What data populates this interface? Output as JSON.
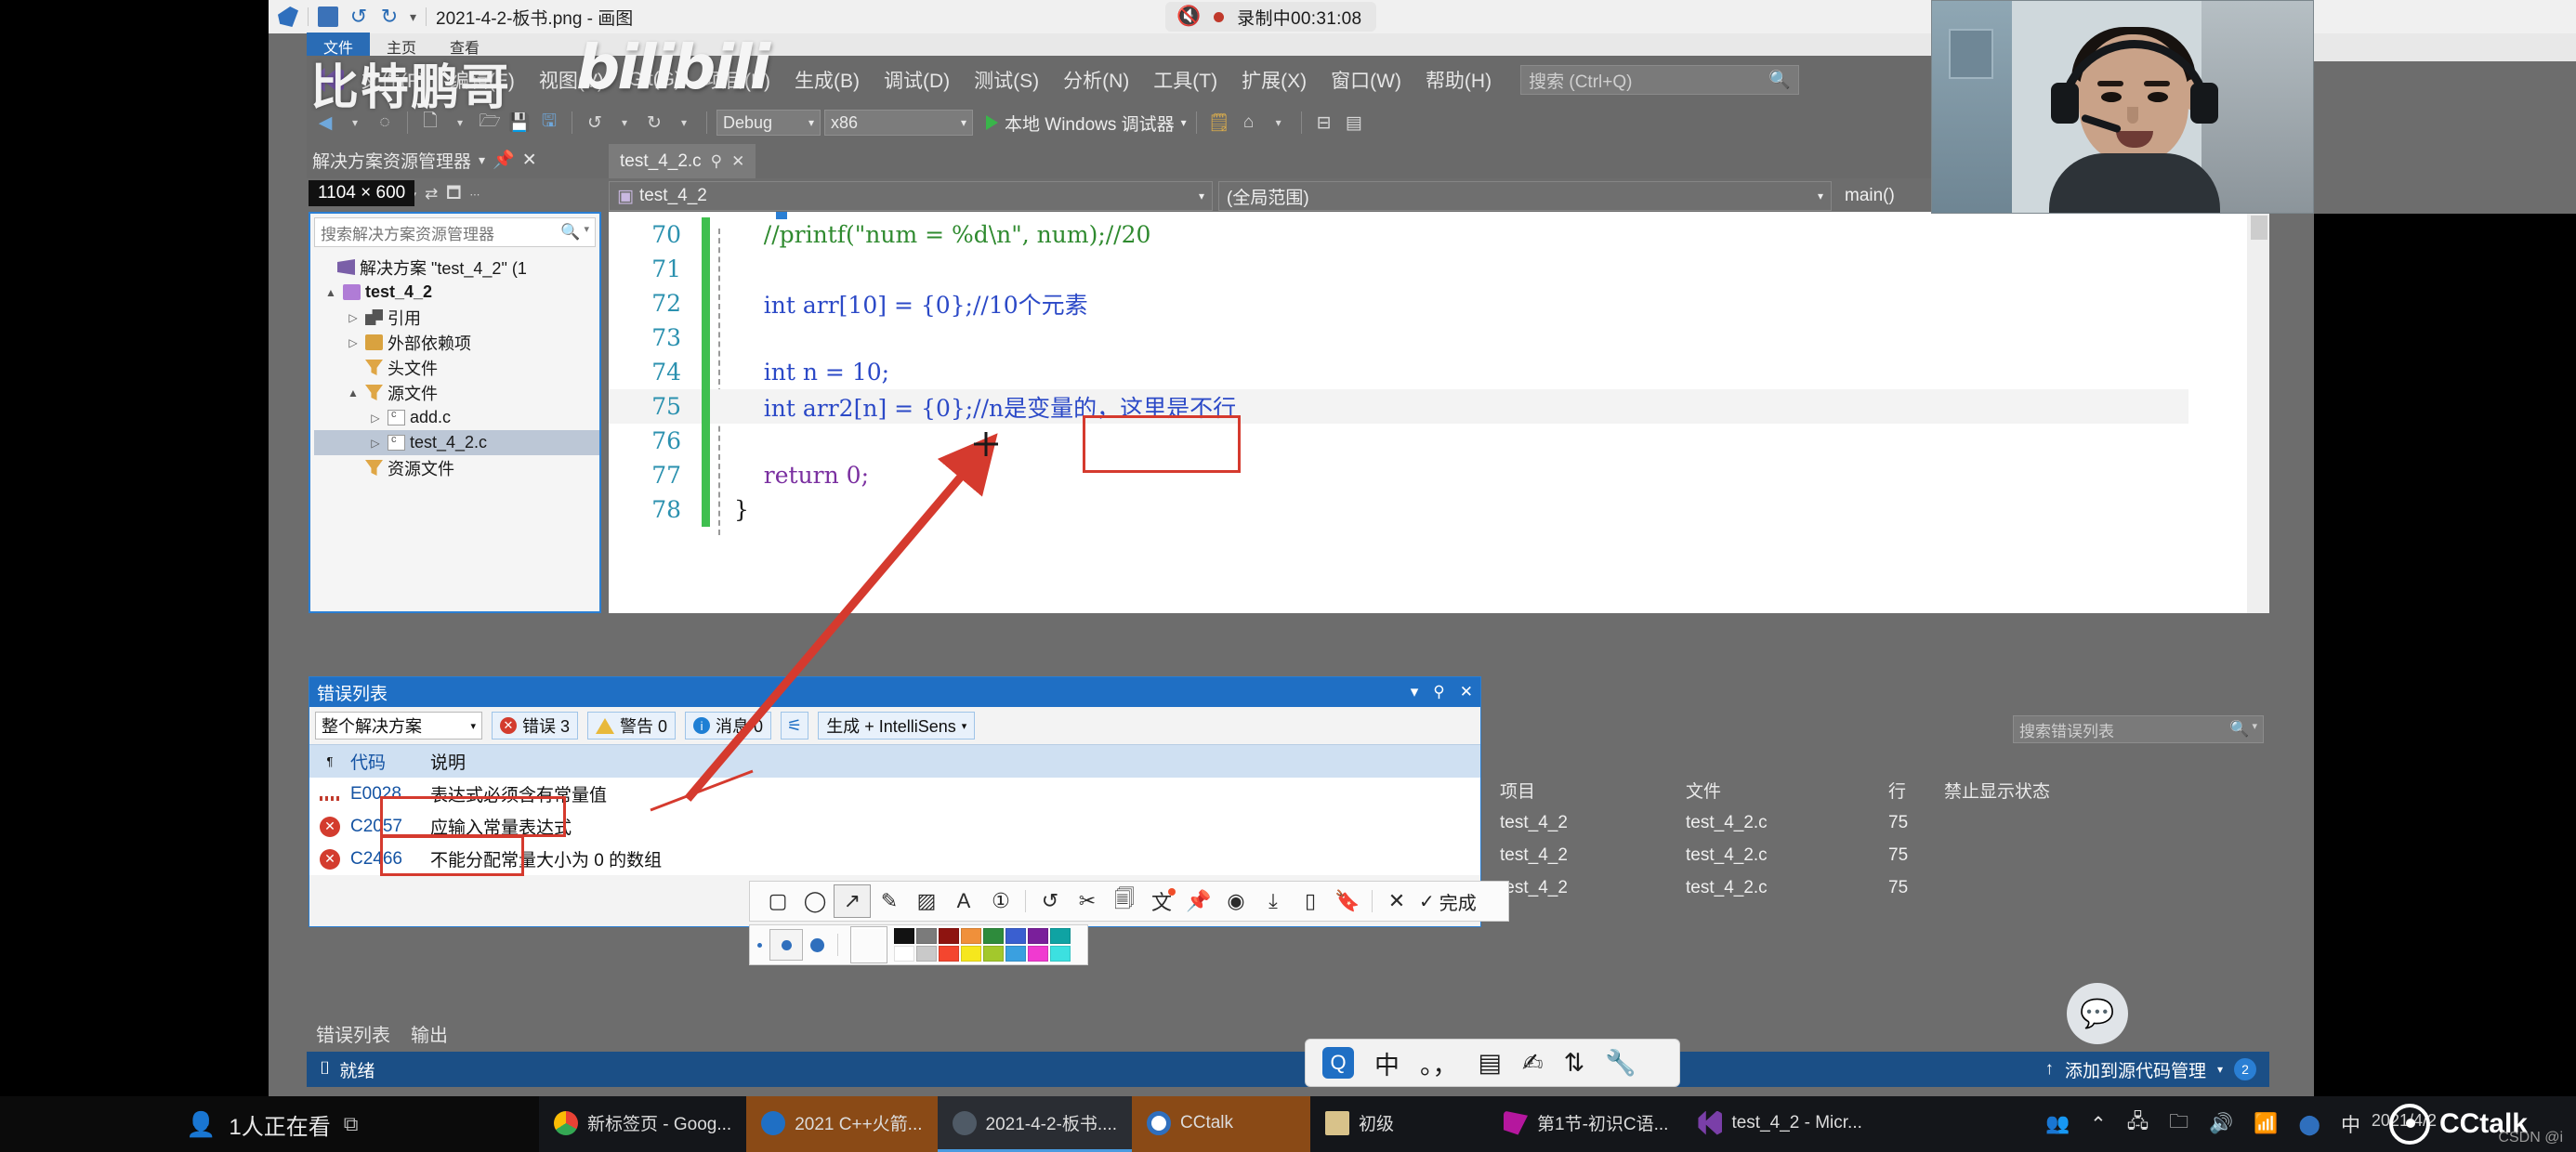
{
  "paint_window": {
    "title": "2021-4-2-板书.png - 画图",
    "icons": [
      "save-icon",
      "undo-icon",
      "redo-icon",
      "customize-icon"
    ],
    "menu": [
      "文件",
      "主页",
      "查看"
    ]
  },
  "recording": {
    "mute_icon": "speaker-mute-icon",
    "label": "录制中00:31:08"
  },
  "watermark": {
    "text": "比特鹏哥",
    "brand": "bilibili"
  },
  "vs": {
    "menu_items": [
      "文件(F)",
      "编辑(E)",
      "视图(V)",
      "Git(G)",
      "项目(P)",
      "生成(B)",
      "调试(D)",
      "测试(S)",
      "分析(N)",
      "工具(T)",
      "扩展(X)",
      "窗口(W)",
      "帮助(H)"
    ],
    "search_placeholder": "搜索 (Ctrl+Q)",
    "toolbar": {
      "config": "Debug",
      "platform": "x86",
      "run_label": "本地 Windows 调试器"
    },
    "solution_explorer": {
      "title": "解决方案资源管理器",
      "search_placeholder": "搜索解决方案资源管理器",
      "size_badge": "1104 × 600",
      "tree": [
        {
          "label": "解决方案 \"test_4_2\" (1",
          "icon": "solution-icon",
          "indent": 0,
          "twisty": "",
          "bold": false
        },
        {
          "label": "test_4_2",
          "icon": "project-icon",
          "indent": 1,
          "twisty": "▲",
          "bold": true
        },
        {
          "label": "引用",
          "icon": "references-icon",
          "indent": 2,
          "twisty": "▷",
          "bold": false
        },
        {
          "label": "外部依赖项",
          "icon": "external-deps-icon",
          "indent": 2,
          "twisty": "▷",
          "bold": false
        },
        {
          "label": "头文件",
          "icon": "filter-folder-icon",
          "indent": 2,
          "twisty": "",
          "bold": false
        },
        {
          "label": "源文件",
          "icon": "filter-folder-icon",
          "indent": 2,
          "twisty": "▲",
          "bold": false
        },
        {
          "label": "add.c",
          "icon": "c-file-icon",
          "indent": 3,
          "twisty": "▷",
          "bold": false
        },
        {
          "label": "test_4_2.c",
          "icon": "c-file-icon",
          "indent": 3,
          "twisty": "▷",
          "bold": false,
          "selected": true
        },
        {
          "label": "资源文件",
          "icon": "filter-folder-icon",
          "indent": 2,
          "twisty": "",
          "bold": false
        }
      ]
    },
    "document_tab": {
      "label": "test_4_2.c",
      "pin": "📌",
      "close": "✕"
    },
    "nav_bar": {
      "project": "test_4_2",
      "scope": "(全局范围)",
      "member": "main()"
    },
    "code": {
      "lines": [
        {
          "num": "70",
          "gutter": "green",
          "text": "    //printf(\"num = %d\\n\", num);//20",
          "kind": "comment"
        },
        {
          "num": "71",
          "gutter": "green",
          "text": "",
          "kind": "plain"
        },
        {
          "num": "72",
          "gutter": "green",
          "text": "    int arr[10] = {0};//10个元素",
          "kind": "decl_comment"
        },
        {
          "num": "73",
          "gutter": "green",
          "text": "",
          "kind": "plain"
        },
        {
          "num": "74",
          "gutter": "green",
          "text": "    int n = 10;",
          "kind": "decl"
        },
        {
          "num": "75",
          "gutter": "green",
          "text": "    int arr2[n] = {0};//n是变量的，这里是不行",
          "kind": "decl_comment",
          "highlight": true
        },
        {
          "num": "76",
          "gutter": "green",
          "text": "",
          "kind": "plain"
        },
        {
          "num": "77",
          "gutter": "green",
          "text": "    return 0;",
          "kind": "return"
        },
        {
          "num": "78",
          "gutter": "green",
          "text": "}",
          "kind": "plain"
        }
      ]
    },
    "error_list": {
      "title": "错误列表",
      "scope_filter": "整个解决方案",
      "errors_label": "错误 3",
      "warnings_label": "警告 0",
      "messages_label": "消息 0",
      "build_filter": "生成 + IntelliSens",
      "search_placeholder": "搜索错误列表",
      "columns": [
        "代码",
        "说明",
        "项目",
        "文件",
        "行",
        "禁止显示状态"
      ],
      "rows": [
        {
          "icon": "squiggle-icon",
          "code": "E0028",
          "desc": "表达式必须含有常量值",
          "project": "test_4_2",
          "file": "test_4_2.c",
          "line": "75",
          "suppress": ""
        },
        {
          "icon": "error-icon",
          "code": "C2057",
          "desc": "应输入常量表达式",
          "project": "test_4_2",
          "file": "test_4_2.c",
          "line": "75",
          "suppress": ""
        },
        {
          "icon": "error-icon",
          "code": "C2466",
          "desc": "不能分配常量大小为 0 的数组",
          "project": "test_4_2",
          "file": "test_4_2.c",
          "line": "75",
          "suppress": ""
        }
      ]
    },
    "bottom_tabs": [
      "错误列表",
      "输出"
    ],
    "status_bar": {
      "left": "就绪",
      "right": "添加到源代码管理",
      "badge": "2"
    }
  },
  "snip_toolbar": {
    "tools": [
      {
        "name": "rectangle-tool",
        "glyph": "▢"
      },
      {
        "name": "ellipse-tool",
        "glyph": "◯"
      },
      {
        "name": "arrow-tool",
        "glyph": "↗",
        "selected": true
      },
      {
        "name": "pen-tool",
        "glyph": "✎"
      },
      {
        "name": "mosaic-tool",
        "glyph": "▨"
      },
      {
        "name": "text-tool",
        "glyph": "A"
      },
      {
        "name": "serial-number-tool",
        "glyph": "①"
      },
      {
        "name": "undo-tool",
        "glyph": "↺"
      },
      {
        "name": "cut-tool",
        "glyph": "✂"
      },
      {
        "name": "ocr-tool",
        "glyph": "🗐"
      },
      {
        "name": "translate-tool",
        "glyph": "文"
      },
      {
        "name": "pin-tool",
        "glyph": "📌"
      },
      {
        "name": "record-tool",
        "glyph": "◉"
      },
      {
        "name": "download-tool",
        "glyph": "⤓"
      },
      {
        "name": "send-to-phone-tool",
        "glyph": "▯"
      },
      {
        "name": "bookmark-tool",
        "glyph": "🔖"
      }
    ],
    "cancel_glyph": "✕",
    "done_glyph": "✓",
    "done_label": "完成"
  },
  "snip_options": {
    "sizes": [
      "small-dot",
      "medium-dot",
      "large-dot"
    ],
    "current_color": "#f4462f",
    "palette_row1": [
      "#121212",
      "#7b7b7b",
      "#8e1410",
      "#f0903a",
      "#2e8b3c",
      "#3a5fd0",
      "#7a1f9b",
      "#0fa3a3"
    ],
    "palette_row2": [
      "#ffffff",
      "#c9c9c9",
      "#f4462f",
      "#f6e71d",
      "#a3c82c",
      "#3aa0e0",
      "#f03ad0",
      "#3ce0e0"
    ]
  },
  "ime_bar": {
    "items": [
      "search-logo-icon",
      "中",
      "。，",
      "keyboard-icon",
      "handwriting-icon",
      "emoji-icon",
      "wrench-icon"
    ]
  },
  "taskbar": {
    "live_label": "1人正在看",
    "items": [
      {
        "label": "新标签页 - Goog...",
        "icon": "chrome-icon",
        "state": "normal"
      },
      {
        "label": "2021 C++火箭...",
        "icon": "doc-icon",
        "state": "orange"
      },
      {
        "label": "2021-4-2-板书....",
        "icon": "paint-icon",
        "state": "active"
      },
      {
        "label": "CCtalk",
        "icon": "cctalk-icon",
        "state": "orange"
      },
      {
        "label": "初级",
        "icon": "book-icon",
        "state": "normal"
      },
      {
        "label": "第1节-初识C语...",
        "icon": "ppt-icon",
        "state": "normal"
      },
      {
        "label": "test_4_2 - Micr...",
        "icon": "vs-icon",
        "state": "normal"
      }
    ],
    "tray": [
      "people-icon",
      "chevron-up-icon",
      "network-icon",
      "folder-icon",
      "volume-icon",
      "wifi-icon",
      "globe-icon",
      "中"
    ],
    "cctalk_label": "CCtalk",
    "date": "2021/4/2"
  },
  "footer_credit": "CSDN @i"
}
